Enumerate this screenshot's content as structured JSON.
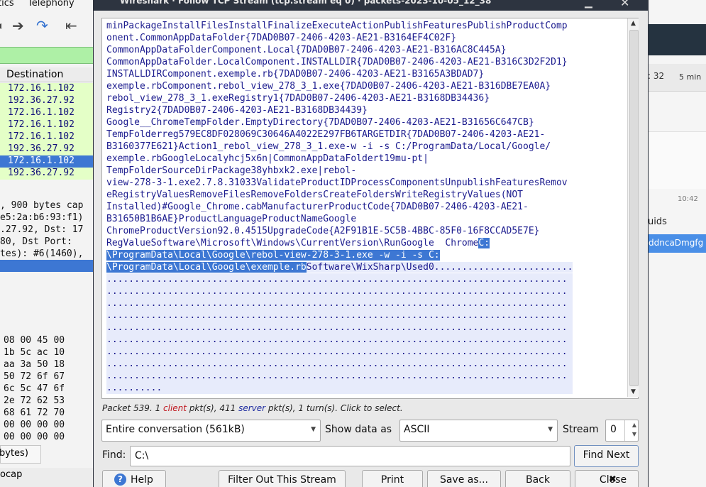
{
  "background_app": {
    "menu": [
      "tics",
      "Telephony"
    ],
    "toolbar_icons": [
      "arrow-right-icon",
      "jump-icon",
      "first-packet-icon"
    ],
    "column_header": "Destination",
    "packet_rows": [
      {
        "dest": "172.16.1.102",
        "selected": false
      },
      {
        "dest": "192.36.27.92",
        "selected": false
      },
      {
        "dest": "172.16.1.102",
        "selected": false
      },
      {
        "dest": "172.16.1.102",
        "selected": false
      },
      {
        "dest": "172.16.1.102",
        "selected": false
      },
      {
        "dest": "192.36.27.92",
        "selected": false
      },
      {
        "dest": "172.16.1.102",
        "selected": true
      },
      {
        "dest": "192.36.27.92",
        "selected": false
      }
    ],
    "detail_lines": [
      ", 900 bytes cap",
      "e5:2a:b6:93:f1)",
      ".27.92, Dst: 17",
      " 80, Dst Port:",
      "tes): #6(1460),"
    ],
    "hex_lines": [
      "08 00 45 00",
      "1b 5c ac 10",
      "aa 3a 50 18",
      "50 72 6f 67",
      "6c 5c 47 6f",
      "2e 72 62 53",
      "68 61 72 70",
      "00 00 00 00",
      "00 00 00 00"
    ],
    "bytes_tab": "bytes)",
    "status_text": "ocap"
  },
  "right_app": {
    "time_a": ": 32",
    "time_b": "5 min",
    "time_c": "10:42",
    "label": "uids",
    "selected_item": "ddncaDmgfg"
  },
  "dialog": {
    "title": "Wireshark · Follow TCP Stream (tcp.stream eq 0) · packets-2023-10-05_12_38",
    "stream_lines": [
      {
        "text": "minPackageInstallFilesInstallFinalizeExecuteActionPublishFeaturesPublishProductComp"
      },
      {
        "text": "onent.CommonAppDataFolder{7DAD0B07-2406-4203-AE21-B3164EF4C02F}"
      },
      {
        "text": "CommonAppDataFolderComponent.Local{7DAD0B07-2406-4203-AE21-B316AC8C445A}"
      },
      {
        "text": "CommonAppDataFolder.LocalComponent.INSTALLDIR{7DAD0B07-2406-4203-AE21-B316C3D2F2D1}"
      },
      {
        "text": "INSTALLDIRComponent.exemple.rb{7DAD0B07-2406-4203-AE21-B3165A3BDAD7}"
      },
      {
        "text": "exemple.rbComponent.rebol_view_278_3_1.exe{7DAD0B07-2406-4203-AE21-B316DBE7EA0A}"
      },
      {
        "text": "rebol_view_278_3_1.exeRegistry1{7DAD0B07-2406-4203-AE21-B3168DB34436}"
      },
      {
        "text": "Registry2{7DAD0B07-2406-4203-AE21-B3168DB34439}"
      },
      {
        "text": "Google__ChromeTempFolder.EmptyDirectory{7DAD0B07-2406-4203-AE21-B31656C647CB}"
      },
      {
        "text": "TempFolderreg579EC8DF028069C30646A4022E297FB6TARGETDIR{7DAD0B07-2406-4203-AE21-"
      },
      {
        "text": "B3160377E621}Action1_rebol_view_278_3_1.exe-w -i -s C:/ProgramData/Local/Google/"
      },
      {
        "text": "exemple.rbGoogleLocalyhcj5x6n|CommonAppDataFoldert19mu-pt|"
      },
      {
        "text": "TempFolderSourceDirPackage38yhbxk2.exe|rebol-"
      },
      {
        "text": "view-278-3-1.exe2.7.8.31033ValidateProductIDProcessComponentsUnpublishFeaturesRemov"
      },
      {
        "text": "eRegistryValuesRemoveFilesRemoveFoldersCreateFoldersWriteRegistryValues(NOT"
      },
      {
        "text": "Installed)#Google_Chrome.cabManufacturerProductCode{7DAD0B07-2406-4203-AE21-"
      },
      {
        "text": "B31650B1B6AE}ProductLanguageProductNameGoogle"
      },
      {
        "text": "ChromeProductVersion92.0.4515UpgradeCode{A2F91B1E-5C5B-4BBC-85F0-16F8CCAD5E7E}"
      },
      {
        "text": "RegValueSoftware\\Microsoft\\Windows\\CurrentVersion\\RunGoogle  Chrome",
        "hl": "C:"
      },
      {
        "text": "",
        "hl": "\\ProgramData\\Local\\Google\\rebol-view-278-3-1.exe -w -i -s C:"
      },
      {
        "text": "",
        "hl": "\\ProgramData\\Local\\Google\\exemple.rb",
        "after": "Software\\WixSharp\\Used0........................."
      },
      {
        "text": "...................................................................................",
        "dots": true
      },
      {
        "text": "...................................................................................",
        "dots": true
      },
      {
        "text": "...................................................................................",
        "dots": true
      },
      {
        "text": "...................................................................................",
        "dots": true
      },
      {
        "text": "...................................................................................",
        "dots": true
      },
      {
        "text": "...................................................................................",
        "dots": true
      },
      {
        "text": "...................................................................................",
        "dots": true
      },
      {
        "text": "...................................................................................",
        "dots": true
      },
      {
        "text": "...................................................................................",
        "dots": true
      },
      {
        "text": "..........",
        "dots": true
      }
    ],
    "info": {
      "prefix": "Packet 539. 1 ",
      "client_word": "client",
      "middle": " pkt(s), 411 ",
      "server_word": "server",
      "suffix": " pkt(s), 1 turn(s). Click to select."
    },
    "conversation_select": "Entire conversation (561kB)",
    "show_data_as_label": "Show data as",
    "encoding_select": "ASCII",
    "stream_label": "Stream",
    "stream_value": "0",
    "find_label": "Find:",
    "find_value": "C:\\",
    "buttons": {
      "find_next": "Find Next",
      "help": "Help",
      "filter_out": "Filter Out This Stream",
      "print": "Print",
      "save_as": "Save as...",
      "back": "Back",
      "close": "Close"
    }
  }
}
